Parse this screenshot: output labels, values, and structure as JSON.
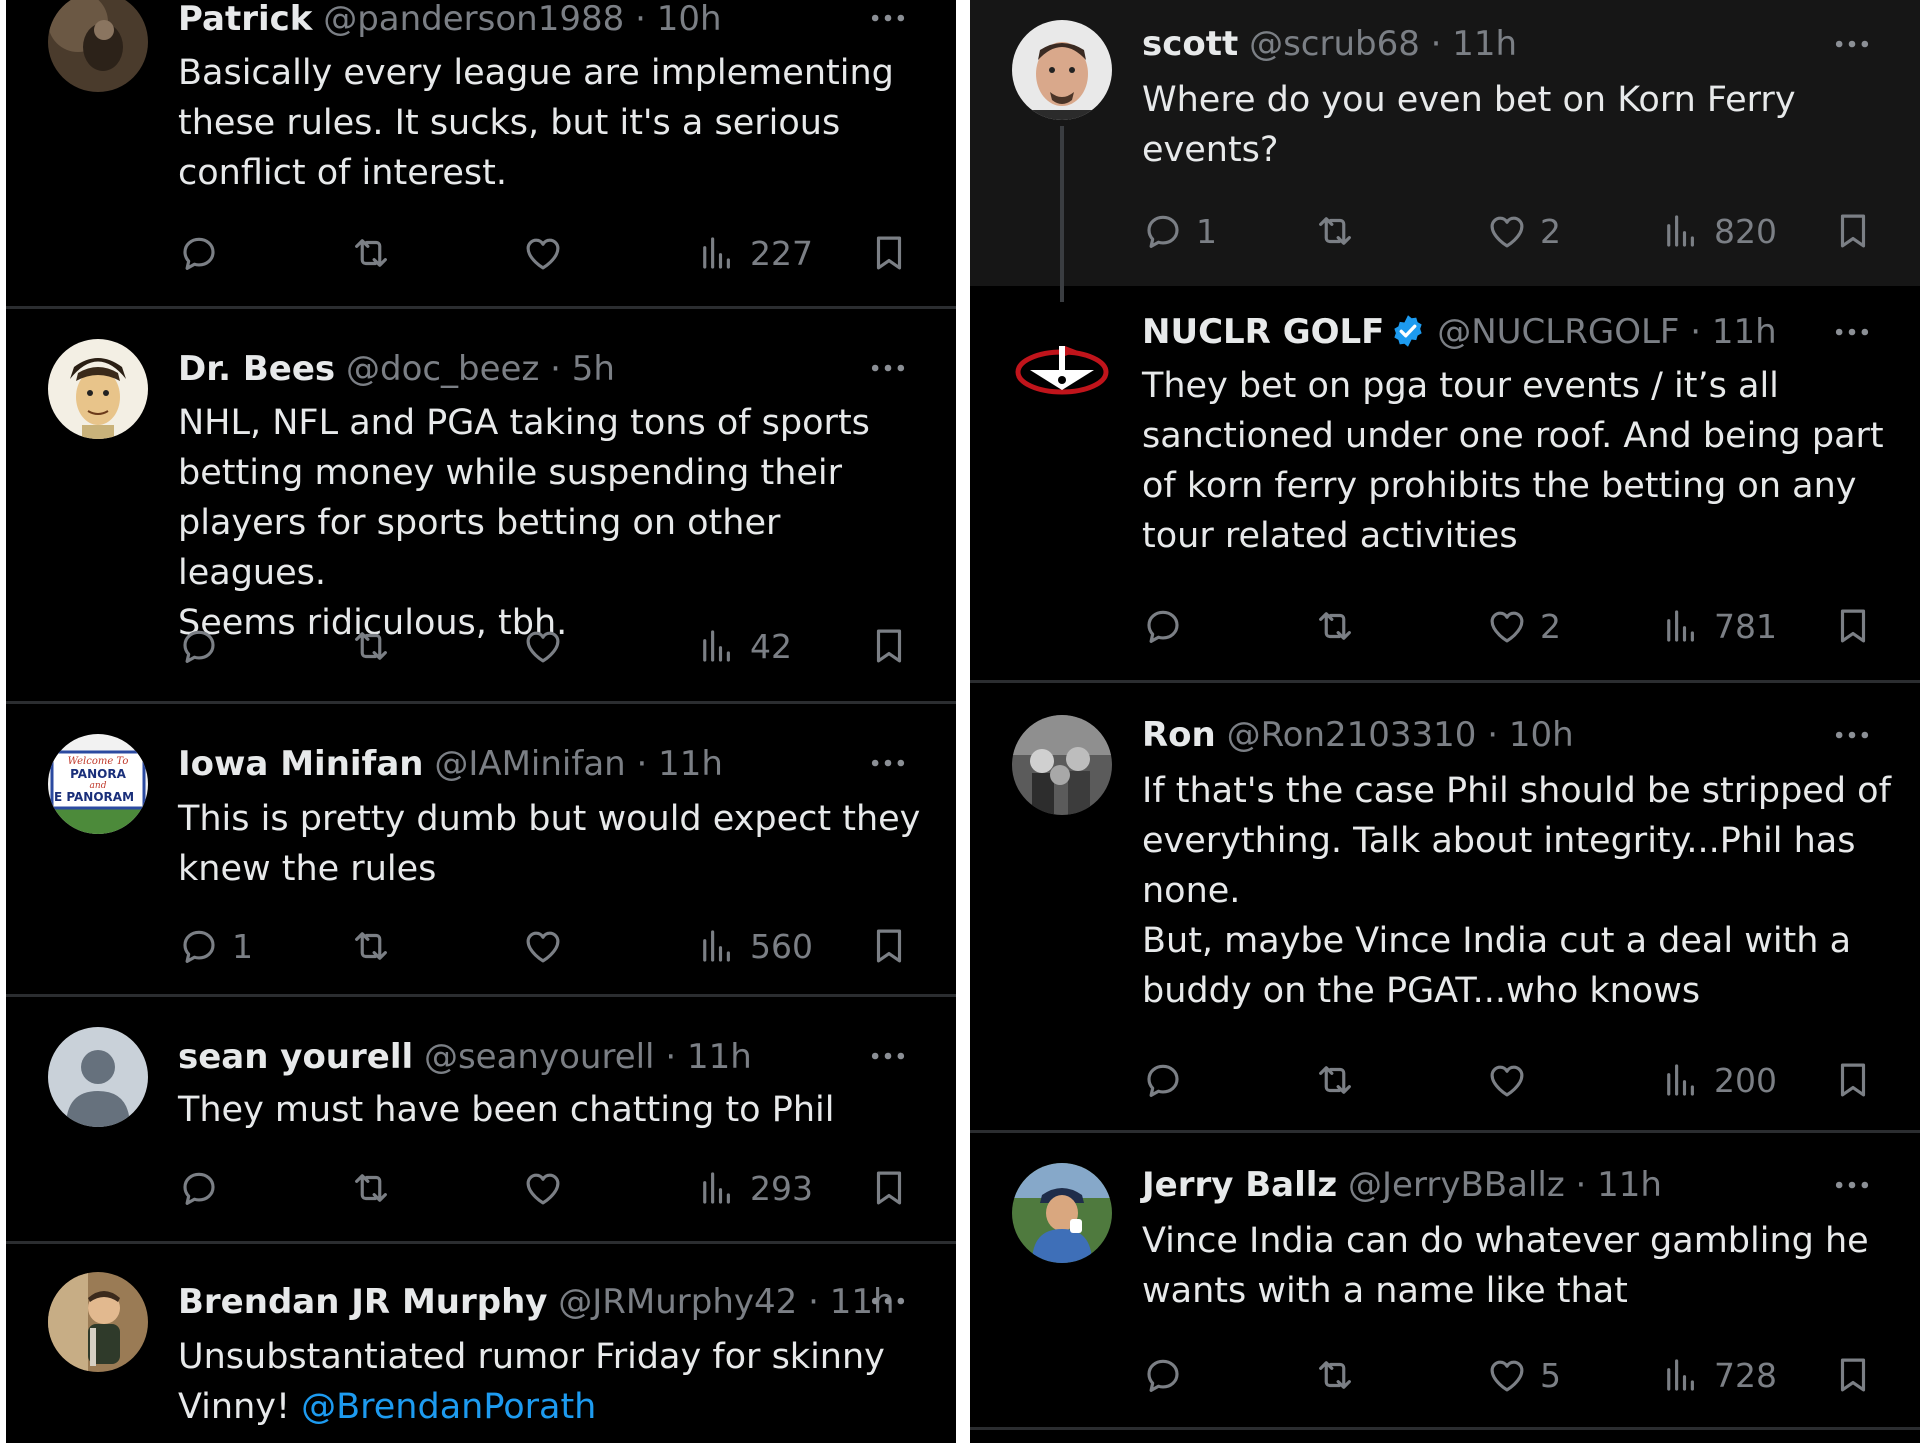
{
  "left": [
    {
      "name": "Patrick",
      "handle": "@panderson1988",
      "time": "10h",
      "text": "Basically every league are implementing\nthese rules. It sucks, but it's a serious\nconflict of interest.",
      "replies": "",
      "likes": "",
      "views": "227"
    },
    {
      "name": "Dr. Bees",
      "handle": "@doc_beez",
      "time": "5h",
      "text": "NHL, NFL and PGA taking tons of sports\nbetting money while suspending their\nplayers for sports betting on other leagues.\nSeems ridiculous, tbh.",
      "replies": "",
      "likes": "",
      "views": "42"
    },
    {
      "name": "Iowa Minifan",
      "handle": "@IAMinifan",
      "time": "11h",
      "text": "This is pretty dumb but would expect they\nknew the rules",
      "replies": "1",
      "likes": "",
      "views": "560",
      "avatar_text": [
        "Welcome To",
        "PANORA",
        "and",
        "E PANORAM"
      ]
    },
    {
      "name": "sean yourell",
      "handle": "@seanyourell",
      "time": "11h",
      "text": "They must have been chatting to Phil",
      "replies": "",
      "likes": "",
      "views": "293"
    },
    {
      "name": "Brendan JR Murphy",
      "handle": "@JRMurphy42",
      "time": "11h",
      "text": "Unsubstantiated rumor Friday for skinny\nVinny! ",
      "mention": "@BrendanPorath"
    }
  ],
  "right": [
    {
      "name": "scott",
      "handle": "@scrub68",
      "time": "11h",
      "text": "Where do you even bet on Korn Ferry\nevents?",
      "replies": "1",
      "likes": "2",
      "views": "820"
    },
    {
      "name": "NUCLR GOLF",
      "handle": "@NUCLRGOLF",
      "time": "11h",
      "text": "They bet on pga tour events / it’s all\nsanctioned under one roof. And being part\nof korn ferry prohibits the betting on any\ntour related activities",
      "replies": "",
      "likes": "2",
      "views": "781"
    },
    {
      "name": "Ron",
      "handle": "@Ron2103310",
      "time": "10h",
      "text": "If that's the case Phil should be stripped of\neverything. Talk about integrity...Phil has\nnone.\nBut, maybe Vince India cut a deal with a\nbuddy on the PGAT...who knows",
      "replies": "",
      "likes": "",
      "views": "200"
    },
    {
      "name": "Jerry Ballz",
      "handle": "@JerryBBallz",
      "time": "11h",
      "text": "Vince India can do whatever gambling he\nwants with a name like that",
      "replies": "",
      "likes": "5",
      "views": "728"
    }
  ],
  "meta_separator": "·",
  "icons": [
    "reply-icon",
    "retweet-icon",
    "like-icon",
    "views-icon",
    "bookmark-icon",
    "more-icon",
    "verified-badge-icon"
  ],
  "colors": {
    "background": "#000000",
    "highlight": "#161616",
    "text": "#e7e9ea",
    "muted": "#7b7f85",
    "link": "#1d9bf0",
    "verified": "#1d9bf0"
  }
}
